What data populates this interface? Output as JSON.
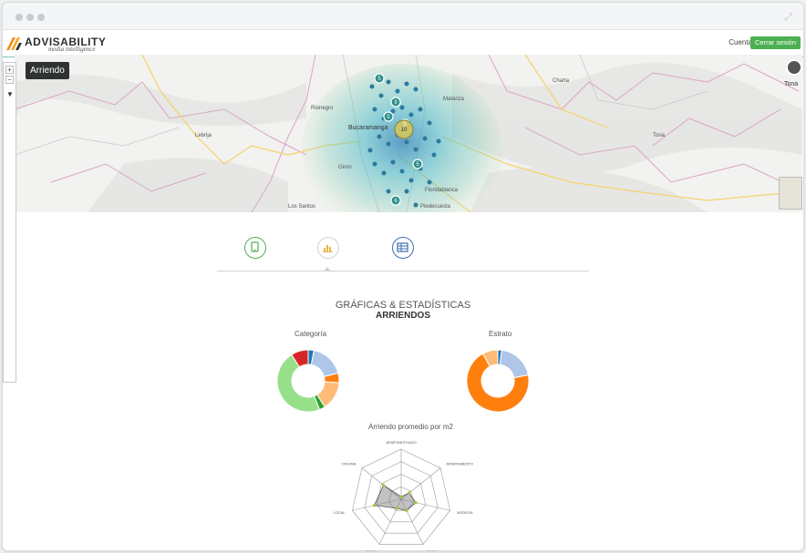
{
  "header": {
    "brand_name": "ADVISABILITY",
    "brand_tagline": "media intelligence",
    "account_label": "Cuenta",
    "logout_label": "Cerrar sesión"
  },
  "map": {
    "layer_tooltip": "Arriendo",
    "right_control_label": "Tona",
    "place_labels": [
      "Lebrija",
      "Bucaramanga",
      "Girón",
      "Floridablanca",
      "Piedecuesta",
      "Matanza",
      "Rionegro",
      "Charta",
      "Tona",
      "Los Santos"
    ],
    "cluster_badges": [
      "5",
      "5",
      "9",
      "5",
      "10",
      "5",
      "6"
    ]
  },
  "tabs": [
    {
      "name": "mobile",
      "icon": "tablet-icon",
      "color": "#4caf50"
    },
    {
      "name": "charts",
      "icon": "bar-chart-icon",
      "color": "#e9b44c"
    },
    {
      "name": "table",
      "icon": "table-icon",
      "color": "#3f6fb5"
    }
  ],
  "stats": {
    "heading": "GRÁFICAS & ESTADÍSTICAS",
    "subheading": "ARRIENDOS"
  },
  "chart_data": [
    {
      "type": "pie",
      "title": "Categoría",
      "categories": [
        "",
        "",
        "",
        "",
        "",
        "",
        ""
      ],
      "values": [
        3,
        18,
        5,
        15,
        3,
        47,
        9
      ],
      "colors": [
        "#1f77b4",
        "#aec7e8",
        "#ff7f0e",
        "#ffbb78",
        "#2ca02c",
        "#98df8a",
        "#d62728"
      ]
    },
    {
      "type": "pie",
      "title": "Estrato",
      "categories": [
        "",
        "",
        "",
        ""
      ],
      "values": [
        2,
        20,
        70,
        8
      ],
      "colors": [
        "#1f77b4",
        "#aec7e8",
        "#ff7f0e",
        "#ffbb78"
      ]
    },
    {
      "type": "radar",
      "title": "Arriendo promedio por m2",
      "categories": [
        "APARTAESTUDIO",
        "APARTAMENTO",
        "BODEGA",
        "CASA",
        "FINCA",
        "LOCAL",
        "OFICINA"
      ],
      "values": [
        0.05,
        0.2,
        0.3,
        0.25,
        0.2,
        0.55,
        0.45
      ]
    }
  ]
}
